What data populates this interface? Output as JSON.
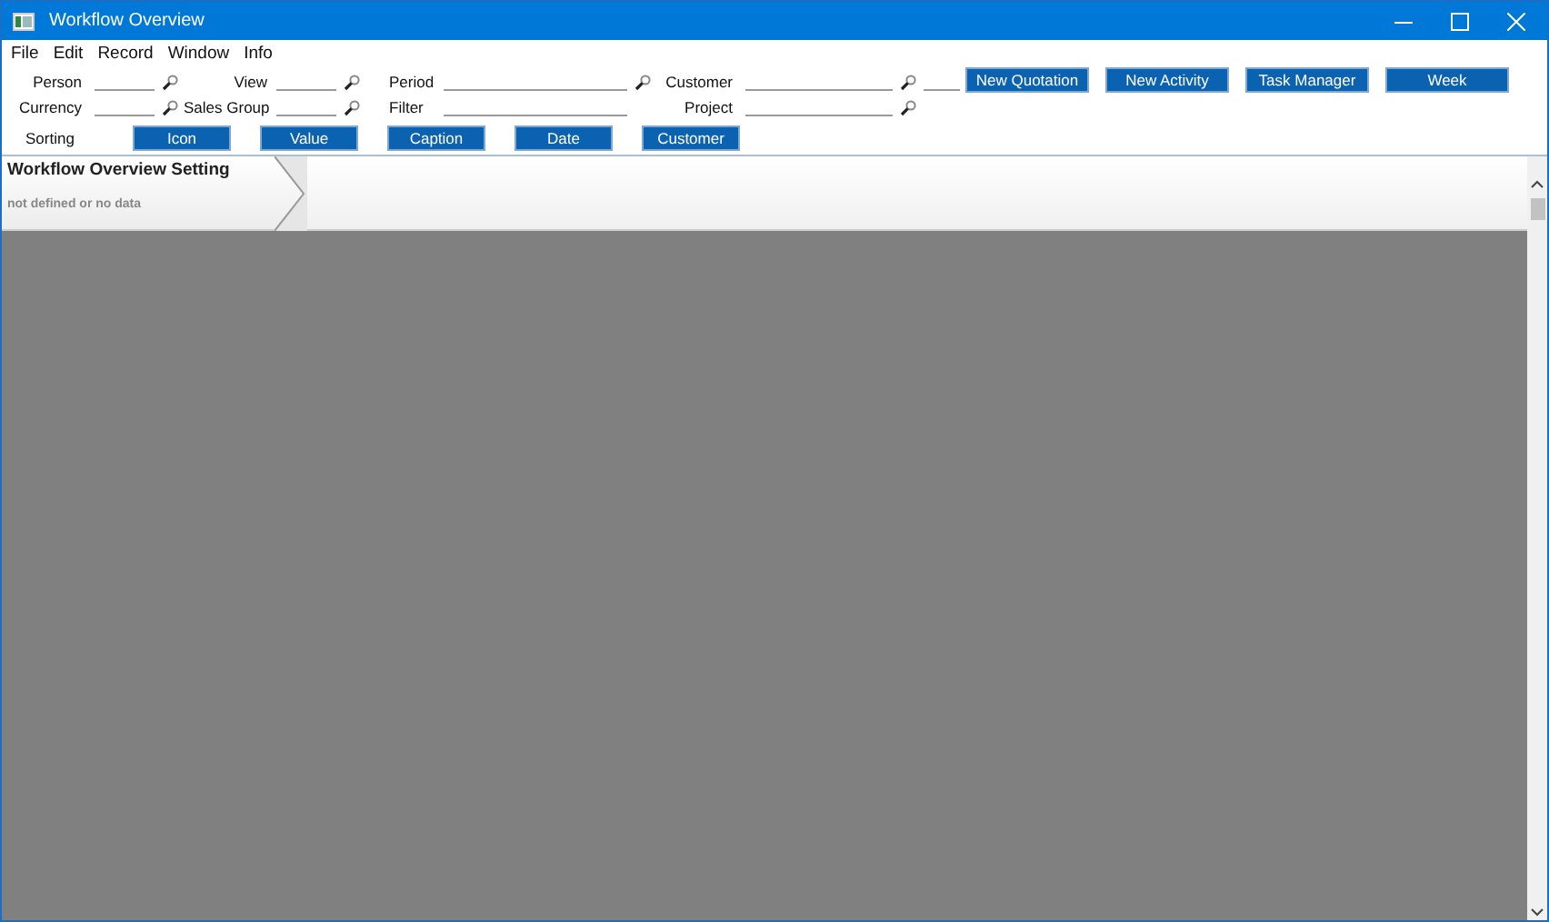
{
  "window": {
    "title": "Workflow Overview"
  },
  "menu": [
    "File",
    "Edit",
    "Record",
    "Window",
    "Info"
  ],
  "filters": [
    {
      "label": "Person",
      "lookup": true
    },
    {
      "label": "View",
      "lookup": true
    },
    {
      "label": "Period",
      "lookup": true
    },
    {
      "label": "Customer",
      "lookup": true,
      "extra_field": true
    },
    {
      "label": "Currency",
      "lookup": true
    },
    {
      "label": "Sales Group",
      "lookup": true
    },
    {
      "label": "Filter",
      "lookup": false
    },
    {
      "label": "Project",
      "lookup": true,
      "extra_field": false
    }
  ],
  "sorting": {
    "label": "Sorting",
    "buttons": [
      "Icon",
      "Value",
      "Caption",
      "Date",
      "Customer"
    ]
  },
  "actions": [
    "New Quotation",
    "New Activity",
    "Task Manager",
    "Week"
  ],
  "panel": {
    "title": "Workflow Overview Setting",
    "status": "not defined or no data"
  }
}
